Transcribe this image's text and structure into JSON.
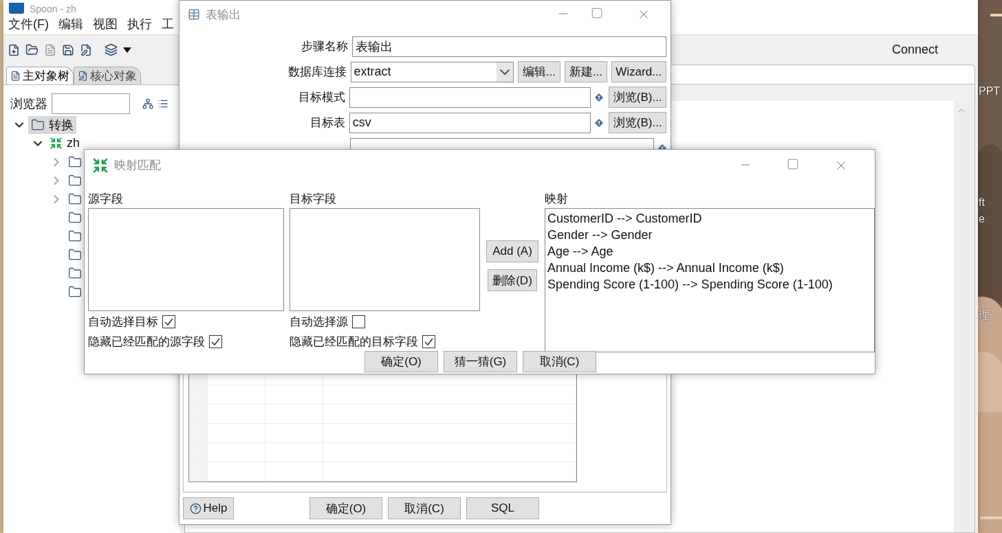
{
  "desktop": {
    "labels": [
      "PPT",
      "ft",
      "e",
      "理"
    ]
  },
  "main_window": {
    "title": "Spoon - zh",
    "menu": [
      "文件(F)",
      "编辑",
      "视图",
      "执行",
      "工"
    ],
    "toolbar_right": "Connect",
    "left_tabs": [
      {
        "label": "主对象树",
        "selected": true
      },
      {
        "label": "核心对象",
        "selected": false
      }
    ],
    "browser": {
      "label": "浏览器"
    },
    "tree": [
      {
        "label": "转换",
        "kind": "branch",
        "expanded": true,
        "selected": true,
        "children": [
          {
            "label": "zh",
            "kind": "transformation",
            "expanded": true,
            "selected": false,
            "children": [
              {
                "kind": "branch",
                "expanded": false,
                "selected": false
              },
              {
                "kind": "branch",
                "expanded": false,
                "selected": false
              },
              {
                "kind": "branch",
                "expanded": false,
                "selected": false
              },
              {
                "kind": "leaf",
                "selected": false
              },
              {
                "kind": "leaf",
                "selected": false
              },
              {
                "kind": "leaf",
                "selected": false
              },
              {
                "kind": "leaf",
                "selected": false
              },
              {
                "kind": "leaf",
                "selected": false
              }
            ]
          }
        ]
      }
    ]
  },
  "table_output_dialog": {
    "title": "表输出",
    "fields": [
      {
        "label": "步骤名称",
        "kind": "text",
        "value": "表输出"
      },
      {
        "label": "数据库连接",
        "kind": "select",
        "value": "extract",
        "buttons": [
          "编辑...",
          "新建...",
          "Wizard..."
        ]
      },
      {
        "label": "目标模式",
        "kind": "variable",
        "buttons": [
          "浏览(B)..."
        ]
      },
      {
        "label": "目标表",
        "kind": "variable",
        "value": "csv",
        "buttons": [
          "浏览(B)..."
        ]
      }
    ],
    "help": "Help",
    "buttons": [
      "确定(O)",
      "取消(C)",
      "SQL"
    ]
  },
  "mapping_dialog": {
    "title": "映射匹配",
    "source_label": "源字段",
    "target_label": "目标字段",
    "mapping_label": "映射",
    "mappings": [
      "CustomerID --> CustomerID",
      "Gender --> Gender",
      "Age --> Age",
      "Annual Income (k$) --> Annual Income (k$)",
      "Spending Score (1-100) --> Spending Score (1-100)"
    ],
    "add": "Add (A)",
    "delete": "删除(D)",
    "source_checks": [
      {
        "label": "自动选择目标",
        "checked": true
      },
      {
        "label": "隐藏已经匹配的源字段",
        "checked": true
      }
    ],
    "target_checks": [
      {
        "label": "自动选择源",
        "checked": false
      },
      {
        "label": "隐藏已经匹配的目标字段",
        "checked": true
      }
    ],
    "buttons": [
      "确定(O)",
      "猜一猜(G)",
      "取消(C)"
    ]
  }
}
